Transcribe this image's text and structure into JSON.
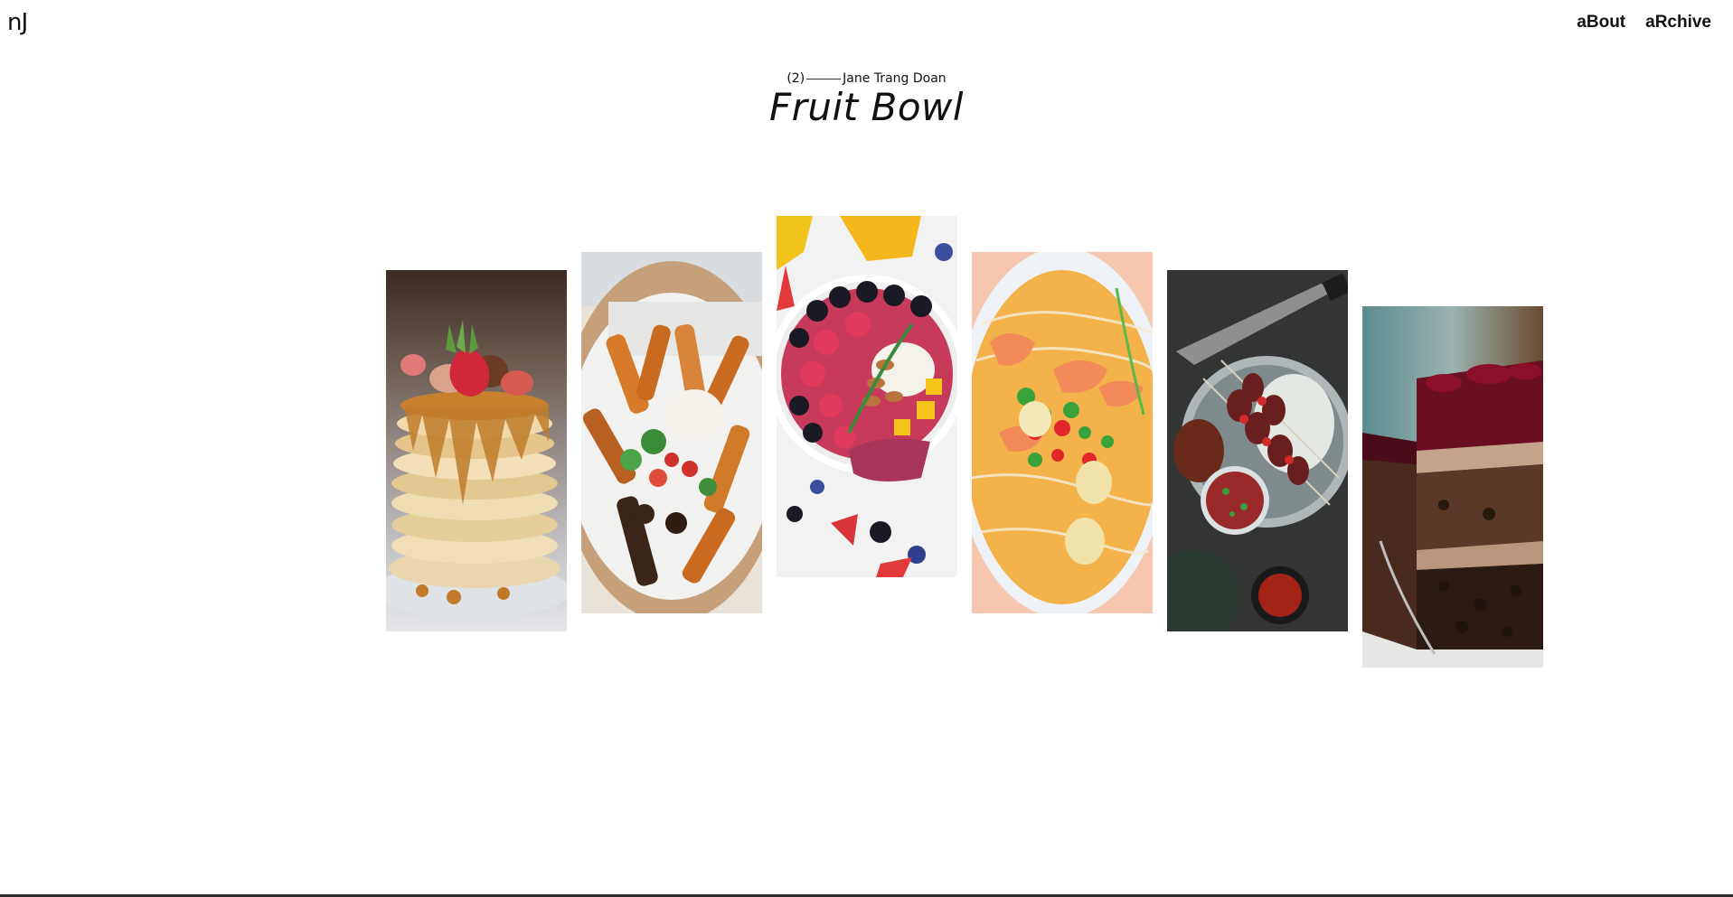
{
  "nav": {
    "logo": "nJ",
    "links": [
      "aBout",
      "aRchive"
    ]
  },
  "header": {
    "index": "(2)",
    "author": "Jane Trang Doan",
    "title": "Fruit Bowl"
  },
  "gallery": {
    "images": [
      {
        "name": "pancake-stack-image"
      },
      {
        "name": "sweet-potato-salad-image"
      },
      {
        "name": "fruit-bowl-image"
      },
      {
        "name": "noodle-soup-image"
      },
      {
        "name": "skewers-plate-image"
      },
      {
        "name": "chocolate-cake-image"
      }
    ]
  }
}
